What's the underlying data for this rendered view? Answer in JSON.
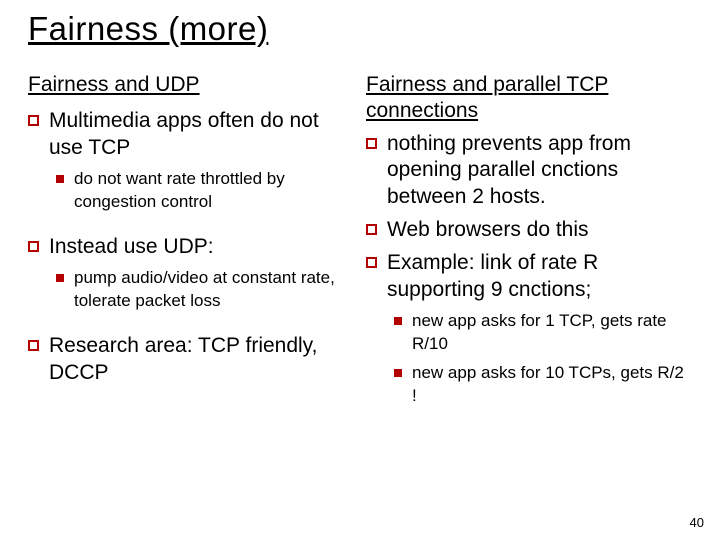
{
  "title": "Fairness (more)",
  "left": {
    "heading": "Fairness and UDP",
    "items": [
      {
        "text": "Multimedia apps often do not use TCP",
        "sub": [
          {
            "text": "do not want rate throttled by congestion control"
          }
        ]
      },
      {
        "text": "Instead use UDP:",
        "sub": [
          {
            "text": "pump audio/video at constant rate, tolerate packet loss"
          }
        ]
      },
      {
        "text": "Research area: TCP friendly, DCCP",
        "sub": []
      }
    ]
  },
  "right": {
    "heading_line1": "Fairness and parallel TCP",
    "heading_line2": "connections",
    "items": [
      {
        "text": "nothing prevents app from opening parallel cnctions between 2 hosts.",
        "sub": []
      },
      {
        "text": "Web browsers do this",
        "sub": []
      },
      {
        "text": "Example: link of rate R supporting 9 cnctions;",
        "sub": [
          {
            "text": "new app asks for 1 TCP, gets rate R/10"
          },
          {
            "text": "new app asks for 10 TCPs, gets R/2 !"
          }
        ]
      }
    ]
  },
  "page_number": "40"
}
